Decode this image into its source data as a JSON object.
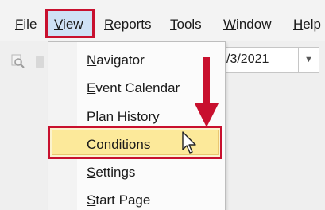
{
  "menubar": {
    "file": {
      "accel": "F",
      "rest": "ile"
    },
    "view": {
      "accel": "V",
      "rest": "iew"
    },
    "reports": {
      "accel": "R",
      "rest": "eports"
    },
    "tools": {
      "accel": "T",
      "rest": "ools"
    },
    "window": {
      "accel": "W",
      "rest": "indow"
    },
    "help": {
      "accel": "H",
      "rest": "elp"
    }
  },
  "toolbar": {
    "date_value": "/3/2021",
    "dropdown_icon": "chevron-down-icon"
  },
  "view_menu": {
    "items": [
      {
        "accel": "N",
        "rest": "avigator"
      },
      {
        "accel": "E",
        "rest": "vent Calendar"
      },
      {
        "accel": "P",
        "rest": "lan History"
      },
      {
        "accel": "C",
        "rest": "onditions"
      },
      {
        "accel": "S",
        "rest": "ettings"
      },
      {
        "accel": "S",
        "rest": "tart Page"
      }
    ],
    "highlighted_index": 3
  },
  "annotations": {
    "arrow_icon": "down-arrow-icon",
    "cursor_icon": "mouse-pointer-icon",
    "highlight_color": "#c8102e"
  }
}
